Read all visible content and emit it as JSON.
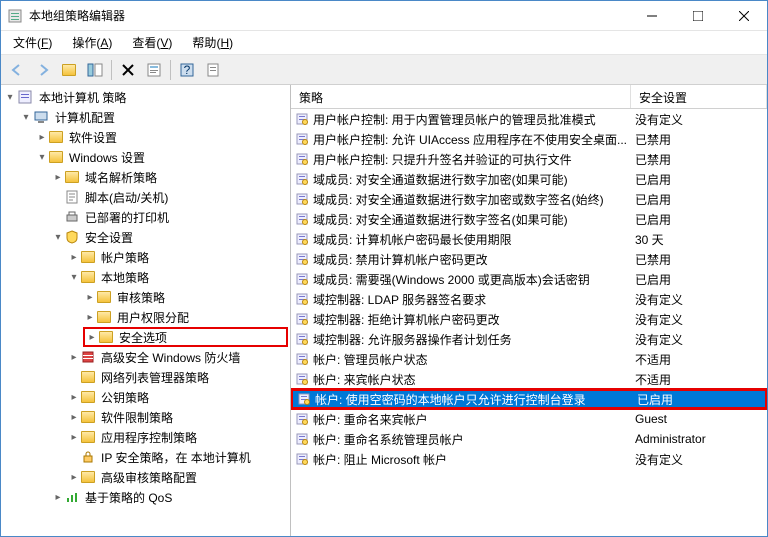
{
  "window": {
    "title": "本地组策略编辑器"
  },
  "menu": {
    "file": "文件",
    "file_hot": "F",
    "action": "操作",
    "action_hot": "A",
    "view": "查看",
    "view_hot": "V",
    "help": "帮助",
    "help_hot": "H"
  },
  "cols": {
    "policy": "策略",
    "setting": "安全设置"
  },
  "tree": {
    "root": "本地计算机 策略",
    "comp": "计算机配置",
    "soft": "软件设置",
    "win": "Windows 设置",
    "dns": "域名解析策略",
    "script": "脚本(启动/关机)",
    "printer": "已部署的打印机",
    "sec": "安全设置",
    "account": "帐户策略",
    "local": "本地策略",
    "audit": "审核策略",
    "rights": "用户权限分配",
    "secopt": "安全选项",
    "firewall": "高级安全 Windows 防火墙",
    "netlist": "网络列表管理器策略",
    "pubkey": "公钥策略",
    "softrest": "软件限制策略",
    "appctrl": "应用程序控制策略",
    "ipsec": "IP 安全策略，在 本地计算机",
    "advaudit": "高级审核策略配置",
    "qos": "基于策略的 QoS"
  },
  "policies": [
    {
      "name": "用户帐户控制: 用于内置管理员帐户的管理员批准模式",
      "setting": "没有定义"
    },
    {
      "name": "用户帐户控制: 允许 UIAccess 应用程序在不使用安全桌面...",
      "setting": "已禁用"
    },
    {
      "name": "用户帐户控制: 只提升升签名并验证的可执行文件",
      "setting": "已禁用"
    },
    {
      "name": "域成员: 对安全通道数据进行数字加密(如果可能)",
      "setting": "已启用"
    },
    {
      "name": "域成员: 对安全通道数据进行数字加密或数字签名(始终)",
      "setting": "已启用"
    },
    {
      "name": "域成员: 对安全通道数据进行数字签名(如果可能)",
      "setting": "已启用"
    },
    {
      "name": "域成员: 计算机帐户密码最长使用期限",
      "setting": "30 天"
    },
    {
      "name": "域成员: 禁用计算机帐户密码更改",
      "setting": "已禁用"
    },
    {
      "name": "域成员: 需要强(Windows 2000 或更高版本)会话密钥",
      "setting": "已启用"
    },
    {
      "name": "域控制器: LDAP 服务器签名要求",
      "setting": "没有定义"
    },
    {
      "name": "域控制器: 拒绝计算机帐户密码更改",
      "setting": "没有定义"
    },
    {
      "name": "域控制器: 允许服务器操作者计划任务",
      "setting": "没有定义"
    },
    {
      "name": "帐户: 管理员帐户状态",
      "setting": "不适用"
    },
    {
      "name": "帐户: 来宾帐户状态",
      "setting": "不适用"
    },
    {
      "name": "帐户: 使用空密码的本地帐户只允许进行控制台登录",
      "setting": "已启用"
    },
    {
      "name": "帐户: 重命名来宾帐户",
      "setting": "Guest"
    },
    {
      "name": "帐户: 重命名系统管理员帐户",
      "setting": "Administrator"
    },
    {
      "name": "帐户: 阻止 Microsoft 帐户",
      "setting": "没有定义"
    }
  ]
}
